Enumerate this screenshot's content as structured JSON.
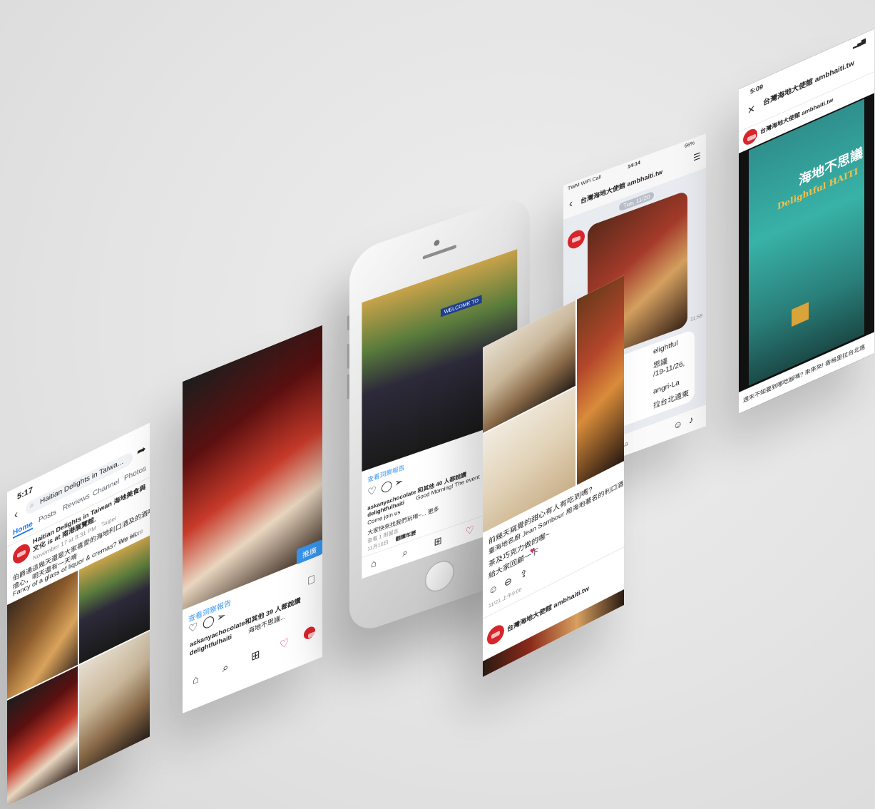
{
  "facebook": {
    "time": "5:17",
    "search_text": "Haitian Delights in Taiwa...",
    "tabs": [
      "Home",
      "Posts",
      "Reviews",
      "Channel",
      "Photos"
    ],
    "page_name": "Haitian Delights in Taiwan 海地美食與文化 is at 南港展覽館.",
    "meta": "November 17 at 8:31 PM · Taipei · ",
    "line1": "伯爵通這幾天還是大家喜愛的海地利口酒及的酒嗎？別",
    "line2": "擔心，明天還有一天唷",
    "line3": "Fancy of a glass of liquor & cremas? We wi...",
    "see_more": "See More"
  },
  "insta_chef": {
    "promo_label": "推廣",
    "insights": "查看洞察報告",
    "likes": "askanyachocolate和其他 39 人都說讚",
    "caption_user": "delightfulhaiti",
    "caption": "海地不思議..."
  },
  "insta_phone": {
    "insights": "查看洞察報告",
    "likes": "askanyachocolate 和其他 40 人都說讚",
    "caption_user": "delightfulhaiti",
    "caption": "Good Morning! The event",
    "caption2": "Come join us",
    "caption3": "大家快來找我們玩唷~... 更多",
    "comments": "查看 1 則留言",
    "date": "11月16日",
    "translate": "翻譯年歷",
    "sign": "WELCOME TO"
  },
  "line_chat": {
    "status_left": "TWM WiFi Call",
    "time": "14:14",
    "battery": "66%",
    "title": "台灣海地大使館 ambhaiti.tw",
    "date_pill": "Tue, 11/20",
    "msg_frag1": "elightful",
    "msg_frag2": "思議",
    "msg_frag3": "/19-11/26,",
    "msg_frag4": "angri-La",
    "msg_frag5": "拉台北遠東",
    "read_time": "11:58",
    "input_hint": "Aa"
  },
  "line_post": {
    "line1": "前幾天窺覺的甜心有人有吃到嗎?",
    "line2": "臺海地名廚 Jean Sambour 用海地著名的利口酒、",
    "line3": "茶及巧克力做的喔~",
    "line4": "給大家回顧一下",
    "timestamp": "11/21 上午9:00",
    "footer_name": "台灣海地大使館 ambhaiti.tw"
  },
  "android": {
    "time": "5:09",
    "title": "台灣海地大使館 ambhaiti.tw",
    "account": "台灣海地大使館 ambhaiti.tw",
    "poster_title": "海地不思議",
    "poster_brand": "Delightful HAITI",
    "caption": "週末不知要到哪吃飯嗎? 來來來! 香格里拉台北遠"
  },
  "colors": {
    "brand_red": "#d8252b",
    "insta_blue": "#3897f0",
    "fb_blue": "#1877f2",
    "background": "#e6e6e6"
  }
}
